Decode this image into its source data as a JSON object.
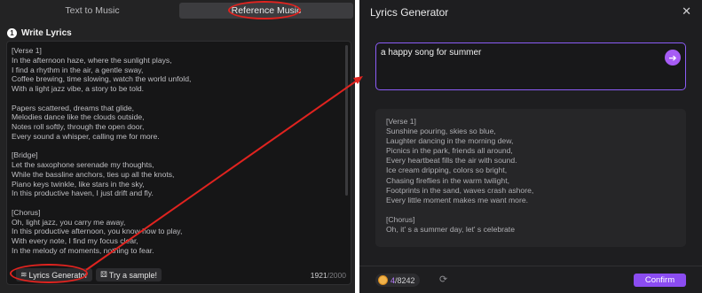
{
  "tabs": {
    "text_to_music": "Text to Music",
    "reference_music": "Reference Music"
  },
  "section": {
    "number": "1",
    "title": "Write Lyrics"
  },
  "lyrics": {
    "text": "[Verse 1]\nIn the afternoon haze, where the sunlight plays,\nI find a rhythm in the air, a gentle sway,\nCoffee brewing, time slowing, watch the world unfold,\nWith a light jazz vibe, a story to be told.\n\nPapers scattered, dreams that glide,\nMelodies dance like the clouds outside,\nNotes roll softly, through the open door,\nEvery sound a whisper, calling me for more.\n\n[Bridge]\nLet the saxophone serenade my thoughts,\nWhile the bassline anchors, ties up all the knots,\nPiano keys twinkle, like stars in the sky,\nIn this productive haven, I just drift and fly.\n\n[Chorus]\nOh, light jazz, you carry me away,\nIn this productive afternoon, you know how to play,\nWith every note, I find my focus clear,\nIn the melody of moments, nothing to fear.",
    "count": "1921",
    "max": "/2000"
  },
  "buttons": {
    "lyrics_generator": "Lyrics Generator",
    "try_sample": "Try a sample!",
    "confirm": "Confirm"
  },
  "dialog": {
    "title": "Lyrics Generator",
    "close_icon": "close-icon",
    "prompt_value": "a happy song for summer",
    "result": "[Verse 1]\nSunshine pouring, skies so blue,\nLaughter dancing in the morning dew,\nPicnics in the park, friends all around,\nEvery heartbeat fills the air with sound.\nIce cream dripping, colors so bright,\nChasing fireflies in the warm twilight,\nFootprints in the sand, waves crash ashore,\nEvery little moment makes me want more.\n\n[Chorus]\nOh, it' s a summer day, let' s celebrate",
    "credits_used": "4",
    "credits_total": "/8242"
  },
  "colors": {
    "accent": "#8b4cf1",
    "annotation": "#e0231f",
    "coin": "#f0b24a"
  }
}
